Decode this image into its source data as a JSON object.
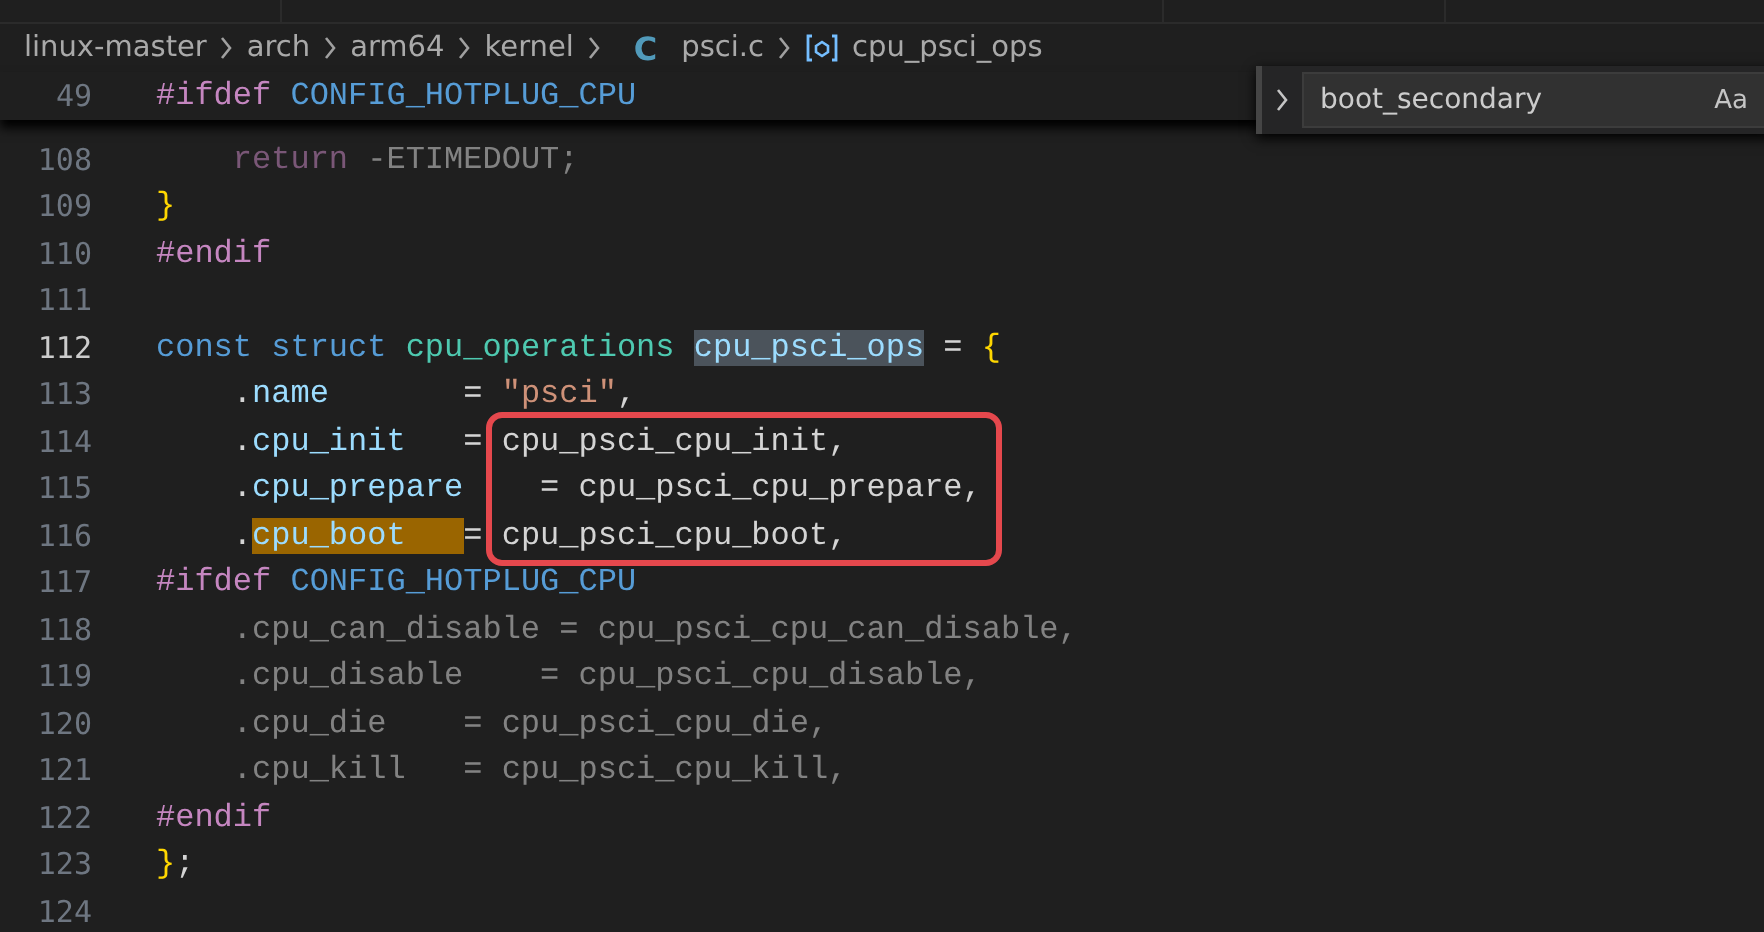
{
  "breadcrumb": [
    {
      "kind": "folder",
      "label": "linux-master"
    },
    {
      "kind": "folder",
      "label": "arch"
    },
    {
      "kind": "folder",
      "label": "arm64"
    },
    {
      "kind": "folder",
      "label": "kernel"
    },
    {
      "kind": "file",
      "icon_text": "C",
      "label": "psci.c"
    },
    {
      "kind": "symbol",
      "label": "cpu_psci_ops"
    }
  ],
  "sticky_line": {
    "number": "49",
    "tokens": [
      {
        "kind": "macro",
        "text": "#ifdef "
      },
      {
        "kind": "keyword",
        "text": "CONFIG_HOTPLUG_CPU"
      }
    ]
  },
  "find_widget": {
    "value": "boot_secondary",
    "options": [
      "Aa"
    ]
  },
  "lines": [
    {
      "number": "108",
      "current": false,
      "dimmed": true,
      "tokens": [
        {
          "kind": "macro",
          "text": "    return "
        },
        {
          "kind": "plain",
          "text": "-ETIMEDOUT;"
        }
      ]
    },
    {
      "number": "109",
      "current": false,
      "dimmed": false,
      "tokens": [
        {
          "kind": "brace",
          "text": "}"
        }
      ]
    },
    {
      "number": "110",
      "current": false,
      "dimmed": false,
      "tokens": [
        {
          "kind": "macro",
          "text": "#endif"
        }
      ]
    },
    {
      "number": "111",
      "current": false
    },
    {
      "number": "112",
      "current": true,
      "dimmed": false,
      "tokens": [
        {
          "kind": "keyword",
          "text": "const struct "
        },
        {
          "kind": "type",
          "text": "cpu_operations "
        },
        {
          "kind": "variable-selected",
          "text": "cpu_psci_ops"
        },
        {
          "kind": "plain",
          "text": " = "
        },
        {
          "kind": "brace",
          "text": "{"
        }
      ]
    },
    {
      "number": "113",
      "current": false,
      "dimmed": false,
      "tokens": [
        {
          "kind": "plain",
          "text": "    ."
        },
        {
          "kind": "property",
          "text": "name"
        },
        {
          "kind": "plain",
          "text": "       = "
        },
        {
          "kind": "string",
          "text": "\"psci\""
        },
        {
          "kind": "plain",
          "text": ","
        }
      ]
    },
    {
      "number": "114",
      "current": false,
      "dimmed": false,
      "tokens": [
        {
          "kind": "plain",
          "text": "    ."
        },
        {
          "kind": "property",
          "text": "cpu_init"
        },
        {
          "kind": "plain",
          "text": "   = cpu_psci_cpu_init,"
        }
      ]
    },
    {
      "number": "115",
      "current": false,
      "dimmed": false,
      "tokens": [
        {
          "kind": "plain",
          "text": "    ."
        },
        {
          "kind": "property",
          "text": "cpu_prepare"
        },
        {
          "kind": "plain",
          "text": "    = cpu_psci_cpu_prepare,"
        }
      ]
    },
    {
      "number": "116",
      "current": false,
      "dimmed": false,
      "tokens": [
        {
          "kind": "plain",
          "text": "    ."
        },
        {
          "kind": "property-match",
          "text": "cpu_boot   "
        },
        {
          "kind": "plain",
          "text": "= cpu_psci_cpu_boot,"
        }
      ]
    },
    {
      "number": "117",
      "current": false,
      "dimmed": false,
      "tokens": [
        {
          "kind": "macro",
          "text": "#ifdef "
        },
        {
          "kind": "keyword",
          "text": "CONFIG_HOTPLUG_CPU"
        }
      ]
    },
    {
      "number": "118",
      "current": false,
      "dimmed": true,
      "tokens": [
        {
          "kind": "plain",
          "text": "    .cpu_can_disable = cpu_psci_cpu_can_disable,"
        }
      ]
    },
    {
      "number": "119",
      "current": false,
      "dimmed": true,
      "tokens": [
        {
          "kind": "plain",
          "text": "    .cpu_disable    = cpu_psci_cpu_disable,"
        }
      ]
    },
    {
      "number": "120",
      "current": false,
      "dimmed": true,
      "tokens": [
        {
          "kind": "plain",
          "text": "    .cpu_die    = cpu_psci_cpu_die,"
        }
      ]
    },
    {
      "number": "121",
      "current": false,
      "dimmed": true,
      "tokens": [
        {
          "kind": "plain",
          "text": "    .cpu_kill   = cpu_psci_cpu_kill,"
        }
      ]
    },
    {
      "number": "122",
      "current": false,
      "dimmed": false,
      "tokens": [
        {
          "kind": "macro",
          "text": "#endif"
        }
      ]
    },
    {
      "number": "123",
      "current": false,
      "dimmed": false,
      "tokens": [
        {
          "kind": "brace",
          "text": "}"
        },
        {
          "kind": "plain",
          "text": ";"
        }
      ]
    },
    {
      "number": "124",
      "current": false
    }
  ],
  "annotation": {
    "kind": "outline",
    "color": "#e5484d"
  }
}
